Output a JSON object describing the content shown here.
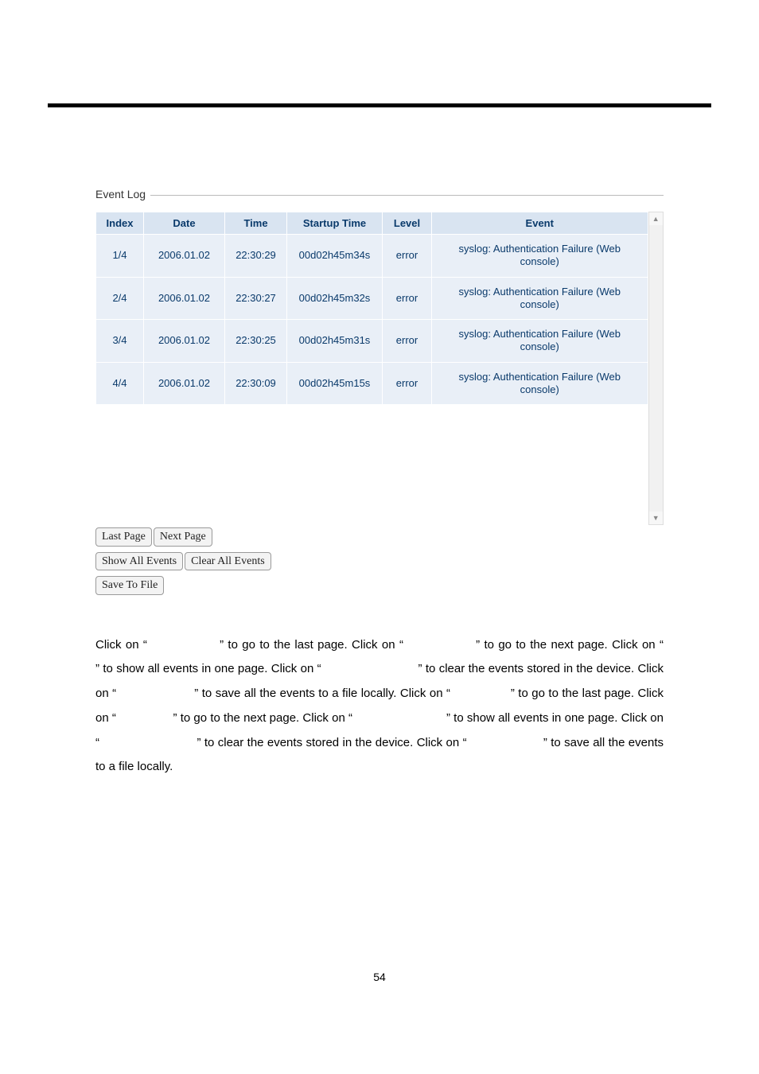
{
  "legend": "Event Log",
  "headers": {
    "index": "Index",
    "date": "Date",
    "time": "Time",
    "startup": "Startup Time",
    "level": "Level",
    "event": "Event"
  },
  "rows": [
    {
      "index": "1/4",
      "date": "2006.01.02",
      "time": "22:30:29",
      "startup": "00d02h45m34s",
      "level": "error",
      "event": "syslog: Authentication Failure (Web console)"
    },
    {
      "index": "2/4",
      "date": "2006.01.02",
      "time": "22:30:27",
      "startup": "00d02h45m32s",
      "level": "error",
      "event": "syslog: Authentication Failure (Web console)"
    },
    {
      "index": "3/4",
      "date": "2006.01.02",
      "time": "22:30:25",
      "startup": "00d02h45m31s",
      "level": "error",
      "event": "syslog: Authentication Failure (Web console)"
    },
    {
      "index": "4/4",
      "date": "2006.01.02",
      "time": "22:30:09",
      "startup": "00d02h45m15s",
      "level": "error",
      "event": "syslog: Authentication Failure (Web console)"
    }
  ],
  "buttons": {
    "last_page": "Last Page",
    "next_page": "Next Page",
    "show_all": "Show All Events",
    "clear_all": "Clear All Events",
    "save_to_file": "Save To File"
  },
  "scroll": {
    "up": "▲",
    "down": "▼"
  },
  "paragraph": "Click on “                 ” to go to the last page. Click on “                 ” to go to the next page. Click on “                           ” to show all events in one page. Click on “                            ” to clear the events stored in the device. Click on “                      ” to save all the events to a file locally. Click on “                 ” to go to the last page. Click on “                 ” to go to the next page. Click on “                            ” to show all events in one page. Click on “                            ” to clear the events stored in the device. Click on “                      ” to save all the events to a file locally.",
  "page_number": "54"
}
